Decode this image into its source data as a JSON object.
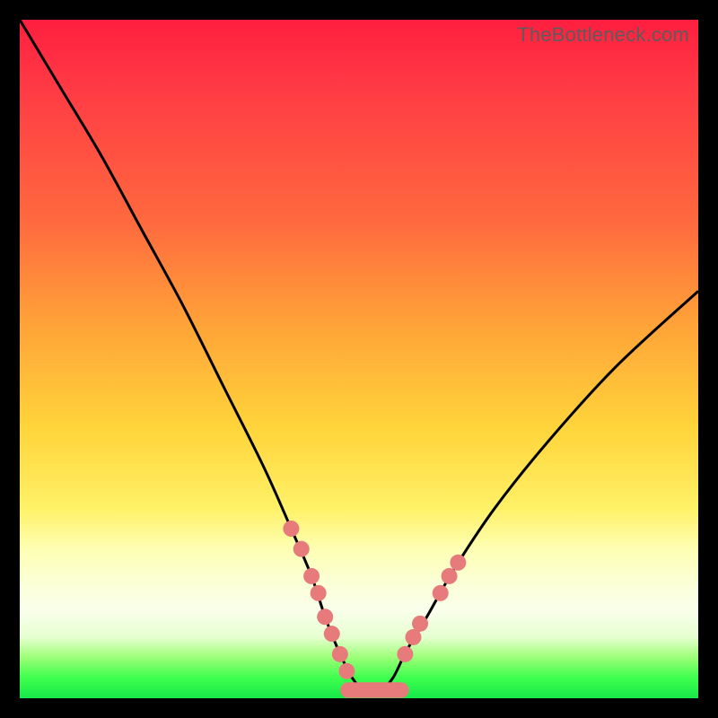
{
  "watermark": "TheBottleneck.com",
  "chart_data": {
    "type": "line",
    "title": "",
    "xlabel": "",
    "ylabel": "",
    "xlim": [
      0,
      100
    ],
    "ylim": [
      0,
      100
    ],
    "series": [
      {
        "name": "bottleneck-curve",
        "x": [
          0,
          6,
          12,
          18,
          24,
          30,
          36,
          40,
          43,
          45,
          47,
          49,
          51,
          53,
          55,
          57,
          60,
          64,
          70,
          78,
          88,
          100
        ],
        "values": [
          100,
          90,
          80,
          69,
          58,
          46,
          34,
          25,
          18,
          12,
          7,
          3,
          1,
          1,
          3,
          7,
          12,
          19,
          28,
          38,
          49,
          60
        ]
      }
    ],
    "annotations": {
      "dots_left": [
        [
          40,
          25
        ],
        [
          41.5,
          22
        ],
        [
          43,
          18
        ],
        [
          44,
          15.5
        ],
        [
          45,
          12
        ],
        [
          46,
          9.5
        ],
        [
          47.2,
          6.5
        ],
        [
          48.2,
          4
        ]
      ],
      "dots_right": [
        [
          56.8,
          6.5
        ],
        [
          58,
          9
        ],
        [
          59,
          11
        ],
        [
          62,
          15.5
        ],
        [
          63.3,
          18
        ],
        [
          64.6,
          20
        ]
      ],
      "flat_bar": {
        "x0": 48.4,
        "x1": 56.2,
        "y": 1.2,
        "thickness": 2.3
      }
    },
    "colors": {
      "curve": "#000000",
      "dots": "#e77b7b",
      "bar": "#e77b7b"
    }
  }
}
